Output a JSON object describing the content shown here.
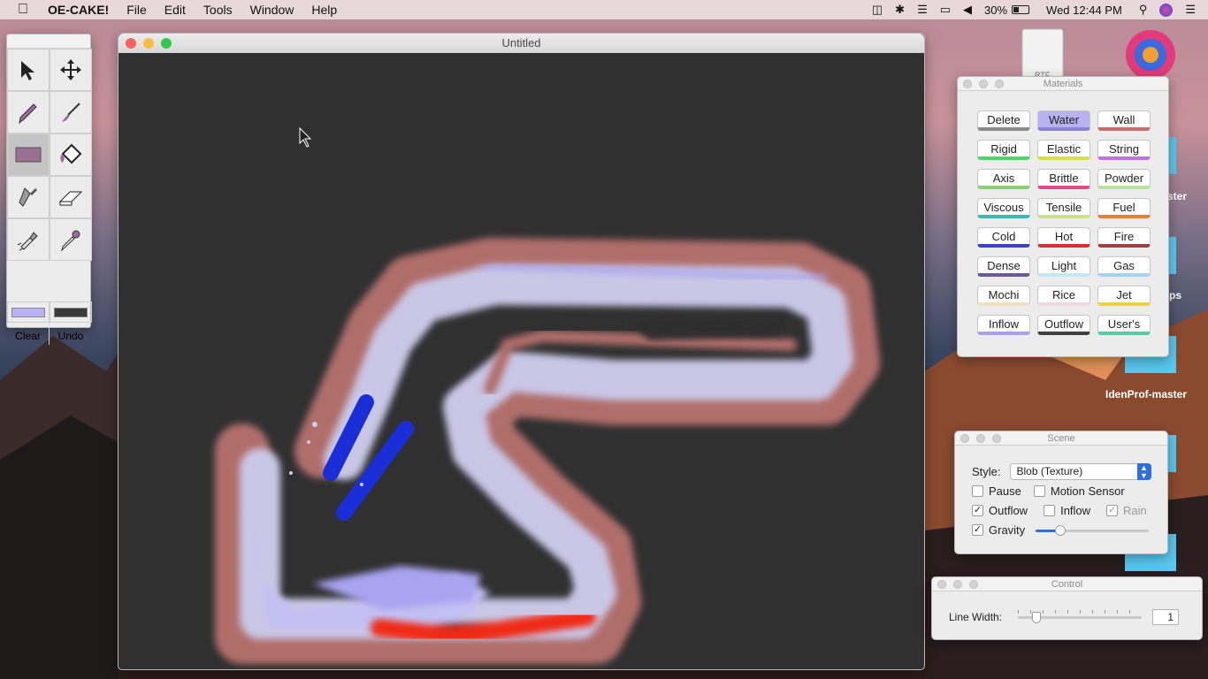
{
  "menubar": {
    "app_name": "OE-CAKE!",
    "menus": [
      "File",
      "Edit",
      "Tools",
      "Window",
      "Help"
    ],
    "battery": "30%",
    "clock": "Wed 12:44 PM"
  },
  "desktop": {
    "icons": [
      "RTF",
      "ster",
      "ps",
      "IdenProf-master"
    ]
  },
  "tools": {
    "buttons": [
      "select-arrow-icon",
      "move-icon",
      "pencil-icon",
      "brush-icon",
      "rectangle-icon",
      "fill-bucket-icon",
      "knife-icon",
      "eraser-icon",
      "flashlight-icon",
      "dropper-icon"
    ],
    "primary_color": "#b8b2f4",
    "secondary_color": "#3a3a3a",
    "clear_label": "Clear",
    "undo_label": "Undo"
  },
  "main_window": {
    "title": "Untitled"
  },
  "materials": {
    "title": "Materials",
    "items": [
      {
        "label": "Delete",
        "color": "#8a8a8a",
        "selected": false
      },
      {
        "label": "Water",
        "color": "#8a84d8",
        "selected": true
      },
      {
        "label": "Wall",
        "color": "#c07070",
        "selected": false
      },
      {
        "label": "Rigid",
        "color": "#4ad86a",
        "selected": false
      },
      {
        "label": "Elastic",
        "color": "#d8e040",
        "selected": false
      },
      {
        "label": "String",
        "color": "#c070e0",
        "selected": false
      },
      {
        "label": "Axis",
        "color": "#8ad070",
        "selected": false
      },
      {
        "label": "Brittle",
        "color": "#e04a8a",
        "selected": false
      },
      {
        "label": "Powder",
        "color": "#b8e0a0",
        "selected": false
      },
      {
        "label": "Viscous",
        "color": "#40b8b0",
        "selected": false
      },
      {
        "label": "Tensile",
        "color": "#c8e090",
        "selected": false
      },
      {
        "label": "Fuel",
        "color": "#e08040",
        "selected": false
      },
      {
        "label": "Cold",
        "color": "#4040c0",
        "selected": false
      },
      {
        "label": "Hot",
        "color": "#d83030",
        "selected": false
      },
      {
        "label": "Fire",
        "color": "#a04040",
        "selected": false
      },
      {
        "label": "Dense",
        "color": "#6a5a9a",
        "selected": false
      },
      {
        "label": "Light",
        "color": "#c0e8f8",
        "selected": false
      },
      {
        "label": "Gas",
        "color": "#a8d0f0",
        "selected": false
      },
      {
        "label": "Mochi",
        "color": "#f0e0c0",
        "selected": false
      },
      {
        "label": "Rice",
        "color": "#f0d8e0",
        "selected": false
      },
      {
        "label": "Jet",
        "color": "#f0d040",
        "selected": false
      },
      {
        "label": "Inflow",
        "color": "#a8a0e8",
        "selected": false
      },
      {
        "label": "Outflow",
        "color": "#404040",
        "selected": false
      },
      {
        "label": "User's",
        "color": "#50d0a0",
        "selected": false
      }
    ]
  },
  "scene": {
    "title": "Scene",
    "style_label": "Style:",
    "style_value": "Blob (Texture)",
    "pause_label": "Pause",
    "motion_label": "Motion Sensor",
    "outflow_label": "Outflow",
    "inflow_label": "Inflow",
    "rain_label": "Rain",
    "gravity_label": "Gravity",
    "gravity_level": 0.22
  },
  "control": {
    "title": "Control",
    "line_width_label": "Line Width:",
    "line_width_value": "1",
    "line_width_level": 0.15
  }
}
